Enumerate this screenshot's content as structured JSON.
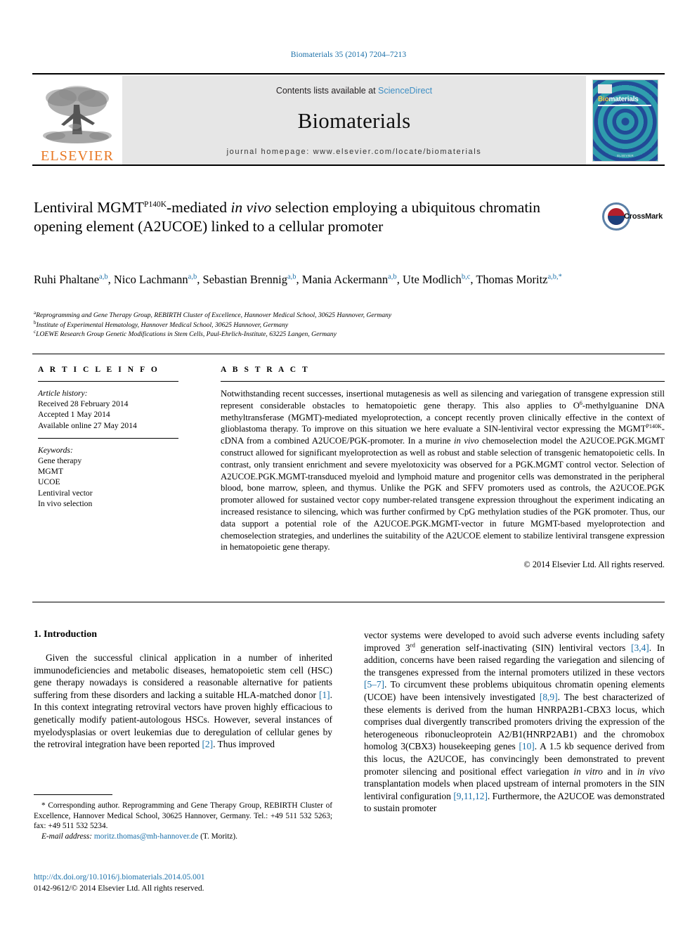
{
  "running_head": "Biomaterials 35 (2014) 7204–7213",
  "masthead": {
    "publisher_name": "ELSEVIER",
    "contents_prefix": "Contents lists available at ",
    "contents_link": "ScienceDirect",
    "journal_name": "Biomaterials",
    "homepage": "journal homepage: www.elsevier.com/locate/biomaterials",
    "cover": {
      "title_part1": "Bio",
      "title_part2": "materials",
      "footer": "ELSEVIER"
    },
    "link_color": "#3f8fc4",
    "elsevier_orange": "#E87722"
  },
  "article": {
    "title_line1_a": "Lentiviral MGMT",
    "title_sup": "P140K",
    "title_line1_b": "-mediated ",
    "title_italic": "in vivo",
    "title_line1_c": " selection employing a ubiquitous chromatin opening element (A2UCOE) linked to a cellular promoter",
    "crossmark_label": "CrossMark",
    "authors": [
      {
        "name": "Ruhi Phaltane",
        "sup": "a,b",
        "sep": ", "
      },
      {
        "name": "Nico Lachmann",
        "sup": "a,b",
        "sep": ", "
      },
      {
        "name": "Sebastian Brennig",
        "sup": "a,b",
        "sep": ", "
      },
      {
        "name": "Mania Ackermann",
        "sup": "a,b",
        "sep": ", "
      },
      {
        "name": "Ute Modlich",
        "sup": "b,c",
        "sep": ", "
      },
      {
        "name": "Thomas Moritz",
        "sup": "a,b,*",
        "sep": ""
      }
    ],
    "affiliations": [
      {
        "marker": "a",
        "text": "Reprogramming and Gene Therapy Group, REBIRTH Cluster of Excellence, Hannover Medical School, 30625 Hannover, Germany"
      },
      {
        "marker": "b",
        "text": "Institute of Experimental Hematology, Hannover Medical School, 30625 Hannover, Germany"
      },
      {
        "marker": "c",
        "text": "LOEWE Research Group Genetic Modifications in Stem Cells, Paul-Ehrlich-Institute, 63225 Langen, Germany"
      }
    ]
  },
  "article_info": {
    "heading": "A R T I C L E   I N F O",
    "history_label": "Article history:",
    "history": [
      "Received 28 February 2014",
      "Accepted 1 May 2014",
      "Available online 27 May 2014"
    ],
    "keywords_label": "Keywords:",
    "keywords": [
      "Gene therapy",
      "MGMT",
      "UCOE",
      "Lentiviral vector",
      "In vivo selection"
    ]
  },
  "abstract": {
    "heading": "A B S T R A C T",
    "p1": "Notwithstanding recent successes, insertional mutagenesis as well as silencing and variegation of transgene expression still represent considerable obstacles to hematopoietic gene therapy. This also applies to O",
    "p1_sup": "6",
    "p2": "-methylguanine DNA methyltransferase (MGMT)-mediated myeloprotection, a concept recently proven clinically effective in the context of glioblastoma therapy. To improve on this situation we here evaluate a SIN-lentiviral vector expressing the MGMT",
    "p2_sup": "P140K",
    "p3_a": "-cDNA from a combined A2UCOE/PGK-promoter. In a murine ",
    "p3_i": "in vivo",
    "p3_b": " chemoselection model the A2UCOE.PGK.MGMT construct allowed for significant myeloprotection as well as robust and stable selection of transgenic hematopoietic cells. In contrast, only transient enrichment and severe myelotoxicity was observed for a PGK.MGMT control vector. Selection of A2UCOE.PGK.MGMT-transduced myeloid and lymphoid mature and progenitor cells was demonstrated in the peripheral blood, bone marrow, spleen, and thymus. Unlike the PGK and SFFV promoters used as controls, the A2UCOE.PGK promoter allowed for sustained vector copy number-related transgene expression throughout the experiment indicating an increased resistance to silencing, which was further confirmed by CpG methylation studies of the PGK promoter. Thus, our data support a potential role of the A2UCOE.PGK.MGMT-vector in future MGMT-based myeloprotection and chemoselection strategies, and underlines the suitability of the A2UCOE element to stabilize lentiviral transgene expression in hematopoietic gene therapy.",
    "copyright": "© 2014 Elsevier Ltd. All rights reserved."
  },
  "introduction": {
    "heading": "1. Introduction",
    "left_a": "Given the successful clinical application in a number of inherited immunodeficiencies and metabolic diseases, hematopoietic stem cell (HSC) gene therapy nowadays is considered a reasonable alternative for patients suffering from these disorders and lacking a suitable HLA-matched donor ",
    "left_ref1": "[1]",
    "left_b": ". In this context integrating retroviral vectors have proven highly efficacious to genetically modify patient-autologous HSCs. However, several instances of myelodysplasias or overt leukemias due to deregulation of cellular genes by the retroviral integration have been reported ",
    "left_ref2": "[2]",
    "left_c": ". Thus improved",
    "right_a": "vector systems were developed to avoid such adverse events including safety improved 3",
    "right_sup": "rd",
    "right_b": " generation self-inactivating (SIN) lentiviral vectors ",
    "right_ref1": "[3,4]",
    "right_c": ". In addition, concerns have been raised regarding the variegation and silencing of the transgenes expressed from the internal promoters utilized in these vectors ",
    "right_ref2": "[5–7]",
    "right_d": ". To circumvent these problems ubiquitous chromatin opening elements (UCOE) have been intensively investigated ",
    "right_ref3": "[8,9]",
    "right_e": ". The best characterized of these elements is derived from the human HNRPA2B1-CBX3 locus, which comprises dual divergently transcribed promoters driving the expression of the heterogeneous ribonucleoprotein A2/B1(HNRP2AB1) and the chromobox homolog 3(CBX3) housekeeping genes ",
    "right_ref4": "[10]",
    "right_f": ". A 1.5 kb sequence derived from this locus, the A2UCOE, has convincingly been demonstrated to prevent promoter silencing and positional effect variegation ",
    "right_i1": "in vitro",
    "right_g": " and in ",
    "right_i2": "in vivo",
    "right_h": " transplantation models when placed upstream of internal promoters in the SIN lentiviral configuration ",
    "right_ref5": "[9,11,12]",
    "right_j": ". Furthermore, the A2UCOE was demonstrated to sustain promoter"
  },
  "footnote": {
    "line1": "* Corresponding author. Reprogramming and Gene Therapy Group, REBIRTH Cluster of Excellence, Hannover Medical School, 30625 Hannover, Germany. Tel.: +49 511 532 5263; fax: +49 511 532 5234.",
    "email_label": "E-mail address:",
    "email": "moritz.thomas@mh-hannover.de",
    "email_suffix": " (T. Moritz)."
  },
  "doi_block": {
    "doi": "http://dx.doi.org/10.1016/j.biomaterials.2014.05.001",
    "issn_line": "0142-9612/© 2014 Elsevier Ltd. All rights reserved."
  }
}
